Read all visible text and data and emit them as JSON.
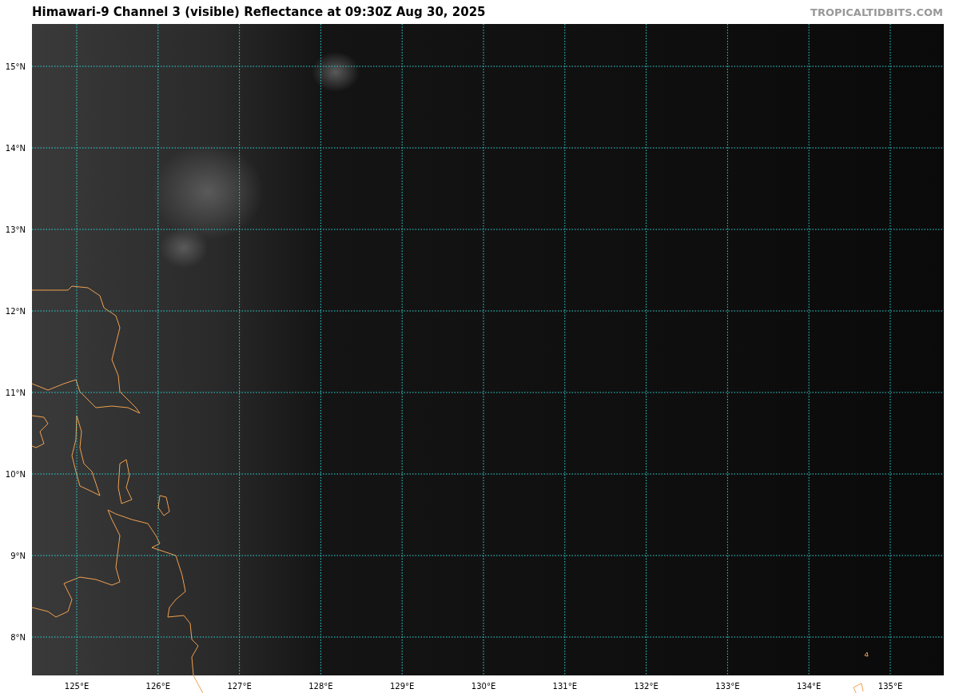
{
  "title": "Himawari-9 Channel 3 (visible) Reflectance at 09:30Z Aug 30, 2025",
  "credit": "TROPICALTIDBITS.COM",
  "map": {
    "lat_labels": [
      "15°N",
      "14°N",
      "13°N",
      "12°N",
      "11°N",
      "10°N",
      "9°N",
      "8°N"
    ],
    "lon_labels": [
      "125°E",
      "126°E",
      "127°E",
      "128°E",
      "129°E",
      "130°E",
      "131°E",
      "132°E",
      "133°E",
      "134°E",
      "135°E"
    ]
  }
}
